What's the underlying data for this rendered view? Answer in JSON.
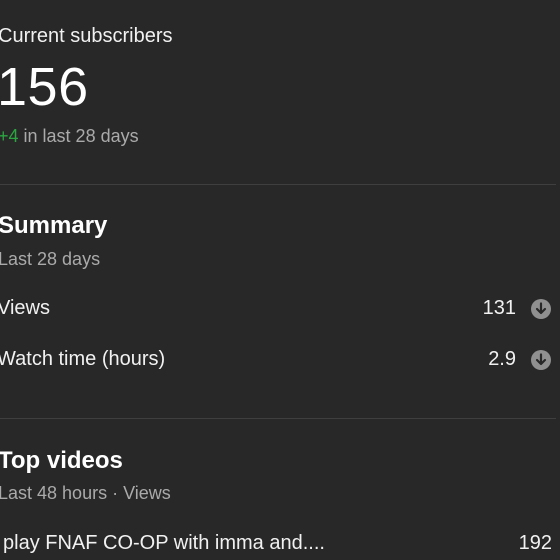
{
  "subscribers": {
    "label": "Current subscribers",
    "count": "156",
    "delta": "+4",
    "delta_text": " in last 28 days",
    "delta_color": "#2ba640"
  },
  "summary": {
    "title": "Summary",
    "period": "Last 28 days",
    "metrics": [
      {
        "label": "Views",
        "value": "131",
        "trend_icon": "arrow-down-circle-icon"
      },
      {
        "label": "Watch time (hours)",
        "value": "2.9",
        "trend_icon": "arrow-down-circle-icon"
      }
    ]
  },
  "top_videos": {
    "title": "Top videos",
    "period": "Last 48 hours · Views",
    "items": [
      {
        "title": "play FNAF CO-OP with imma and....",
        "views": "192"
      }
    ]
  }
}
